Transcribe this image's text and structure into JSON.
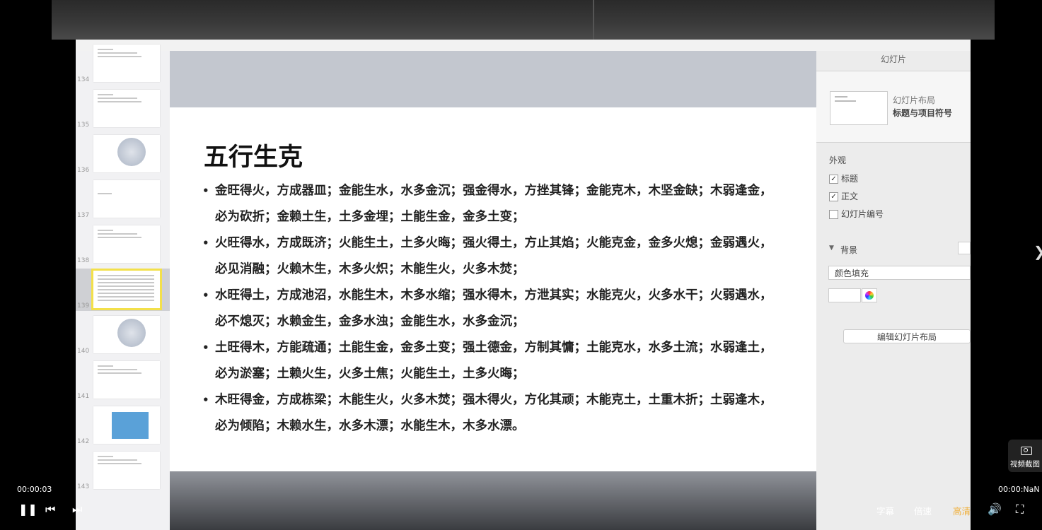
{
  "slide": {
    "title": "五行生克",
    "bullets": [
      "金旺得火，方成器皿；金能生水，水多金沉；强金得水，方挫其锋；金能克木，木坚金缺；木弱逢金，\n必为砍折；金赖土生，土多金埋；土能生金，金多土变；",
      "火旺得水，方成既济；火能生土，土多火晦；强火得土，方止其焰；火能克金，金多火熄；金弱遇火，\n必见消融；火赖木生，木多火炽；木能生火，火多木焚；",
      "水旺得土，方成池沼，水能生木，木多水缩；强水得木，方泄其实；水能克火，火多水干；火弱遇水，\n必不熄灭；水赖金生，金多水浊；金能生水，水多金沉；",
      "土旺得木，方能疏通；土能生金，金多土变；强土德金，方制其慵；土能克水，水多土流；水弱逢土，\n必为淤塞；土赖火生，火多土焦；火能生土，土多火晦；",
      "木旺得金，方成栋梁；木能生火，火多木焚；强木得火，方化其顽；木能克土，土重木折；土弱逢木，\n必为倾陷；木赖水生，水多木漂；水能生木，木多水漂。"
    ]
  },
  "navigator": {
    "slides": [
      {
        "num": "134",
        "kind": "text"
      },
      {
        "num": "135",
        "kind": "text"
      },
      {
        "num": "136",
        "kind": "circle"
      },
      {
        "num": "137",
        "kind": "blank"
      },
      {
        "num": "138",
        "kind": "text"
      },
      {
        "num": "139",
        "kind": "dense",
        "selected": true
      },
      {
        "num": "140",
        "kind": "circle"
      },
      {
        "num": "141",
        "kind": "text"
      },
      {
        "num": "142",
        "kind": "map"
      },
      {
        "num": "143",
        "kind": "text"
      }
    ]
  },
  "inspector": {
    "panel_title": "幻灯片",
    "layout_label": "幻灯片布局",
    "layout_name": "标题与项目符号",
    "appearance_label": "外观",
    "appearance_options": [
      {
        "label": "标题",
        "checked": true
      },
      {
        "label": "正文",
        "checked": true
      },
      {
        "label": "幻灯片编号",
        "checked": false
      }
    ],
    "background_label": "背景",
    "fill_type": "颜色填充",
    "edit_layout_button": "编辑幻灯片布局"
  },
  "player": {
    "current_time": "00:00:03",
    "duration": "00:00:NaN",
    "subtitles_label": "字幕",
    "speed_label": "倍速",
    "quality_label": "高清",
    "screenshot_label": "视频截图",
    "quality_color": "#f0b03c"
  }
}
